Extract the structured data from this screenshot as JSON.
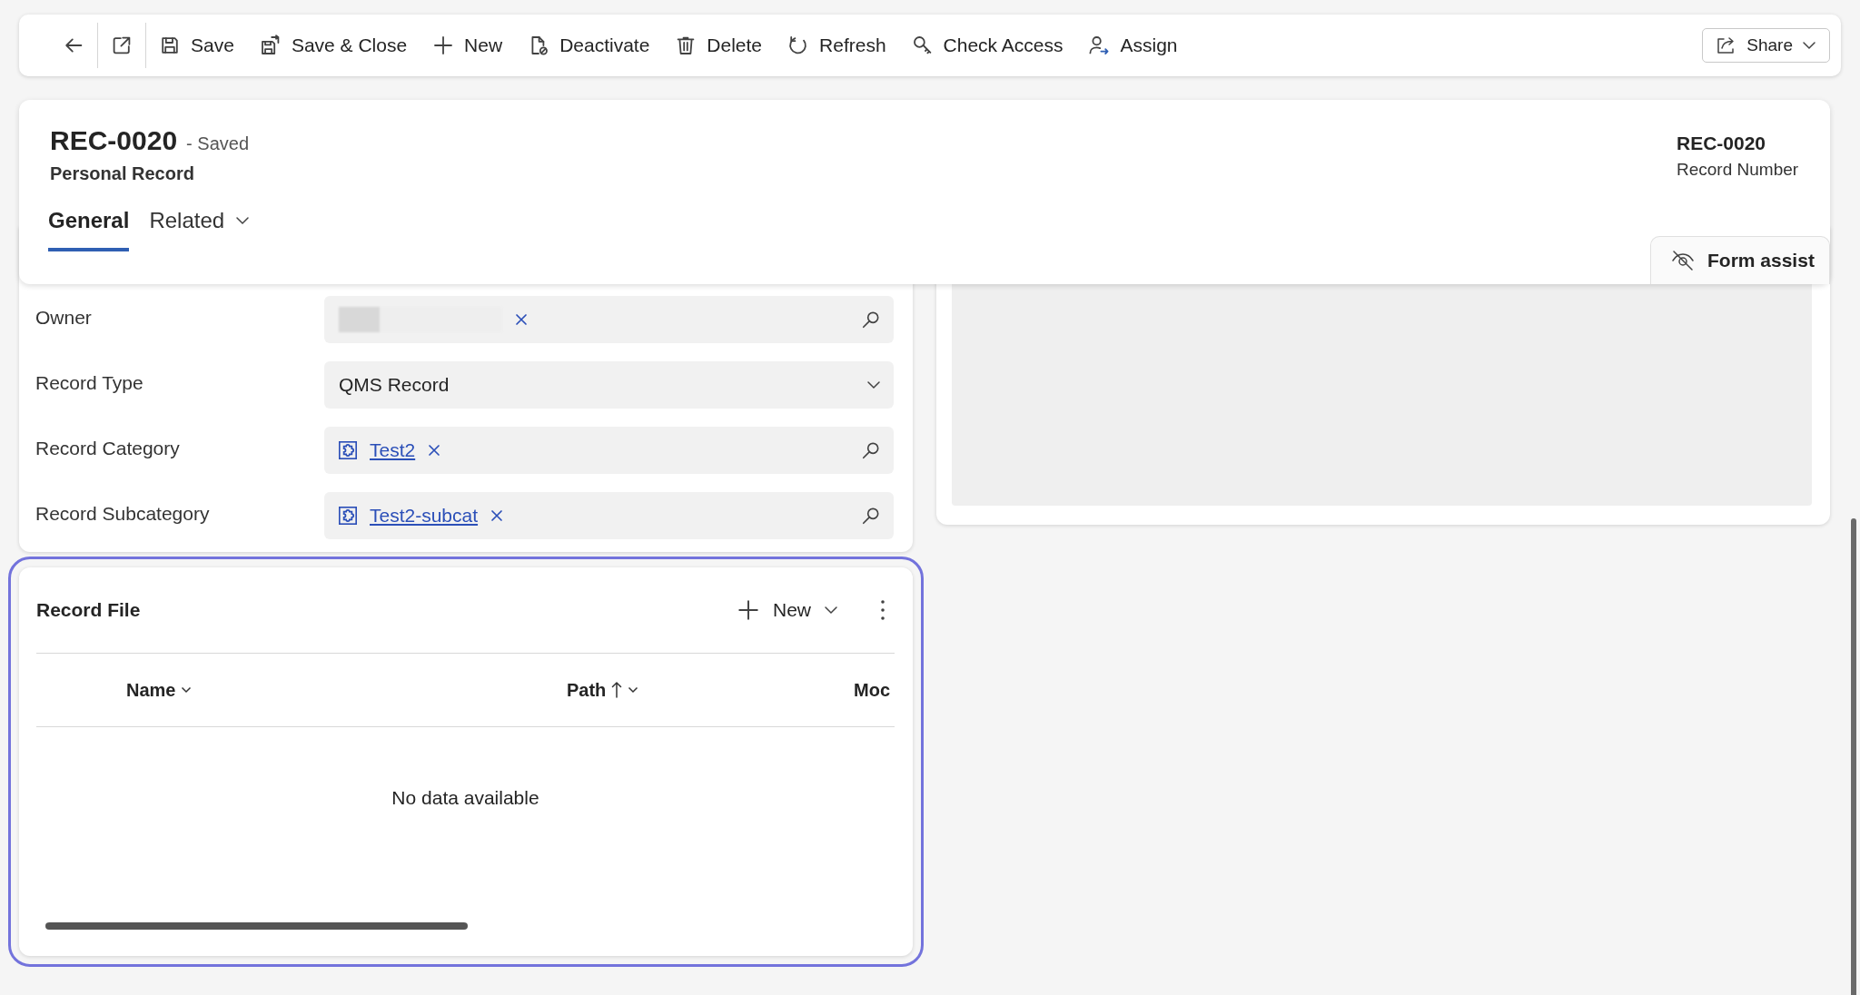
{
  "toolbar": {
    "items": [
      {
        "kind": "back"
      },
      {
        "kind": "popout"
      },
      {
        "kind": "save",
        "label": "Save"
      },
      {
        "kind": "saveclose",
        "label": "Save & Close"
      },
      {
        "kind": "new",
        "label": "New"
      },
      {
        "kind": "deactivate",
        "label": "Deactivate"
      },
      {
        "kind": "delete",
        "label": "Delete"
      },
      {
        "kind": "refresh",
        "label": "Refresh"
      },
      {
        "kind": "access",
        "label": "Check Access"
      },
      {
        "kind": "assign",
        "label": "Assign"
      }
    ],
    "share": "Share"
  },
  "header": {
    "title": "REC-0020",
    "status": "- Saved",
    "entity": "Personal Record",
    "tabs": [
      {
        "label": "General",
        "selected": true
      },
      {
        "label": "Related",
        "selected": false
      }
    ],
    "key_field": {
      "value": "REC-0020",
      "label": "Record Number"
    },
    "form_assist": "Form assist"
  },
  "fields": [
    {
      "label": "Owner",
      "kind": "redacted"
    },
    {
      "label": "Record Type",
      "kind": "select",
      "value": "QMS Record"
    },
    {
      "label": "Record Category",
      "kind": "lookup",
      "value": "Test2"
    },
    {
      "label": "Record Subcategory",
      "kind": "lookup",
      "value": "Test2-subcat"
    }
  ],
  "subgrid": {
    "title": "Record File",
    "new_label": "New",
    "focused": true,
    "columns": [
      {
        "label": "Name",
        "sorted": false
      },
      {
        "label": "Path",
        "sorted": true
      },
      {
        "label": "Moc",
        "sorted": false
      }
    ],
    "empty_text": "No data available"
  }
}
